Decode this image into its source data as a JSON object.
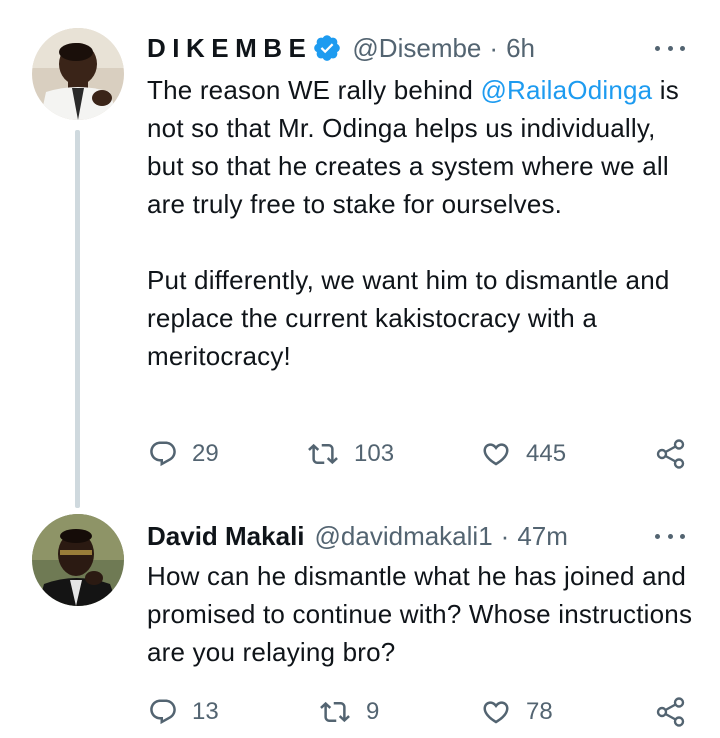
{
  "tweets": [
    {
      "author_name": "DIKEMBE",
      "verified": true,
      "handle": "@Disembe",
      "separator": "·",
      "time": "6h",
      "mention": "@RailaOdinga",
      "line1_prefix": "The reason WE rally behind ",
      "line1_rest": "is not so that Mr. Odinga helps us individually, but so that he creates a system where we all are truly free to stake for ourselves.",
      "paragraph2": "Put differently, we want him to dismantle and replace the current kakistocracy with a meritocracy!",
      "replies": "29",
      "retweets": "103",
      "likes": "445"
    },
    {
      "author_name": "David Makali",
      "handle": "@davidmakali1",
      "separator": "·",
      "time": "47m",
      "text": "How can he dismantle what he has joined and promised to continue with? Whose instructions are you relaying bro?",
      "replies": "13",
      "retweets": "9",
      "likes": "78"
    }
  ],
  "icons": {
    "reply": "reply-icon",
    "retweet": "retweet-icon",
    "like": "heart-icon",
    "share": "share-icon",
    "more": "more-icon",
    "verified": "verified-badge-icon"
  },
  "colors": {
    "text": "#0f1419",
    "secondary": "#536471",
    "link": "#1d9bf0",
    "thread_line": "#cfd9de"
  }
}
